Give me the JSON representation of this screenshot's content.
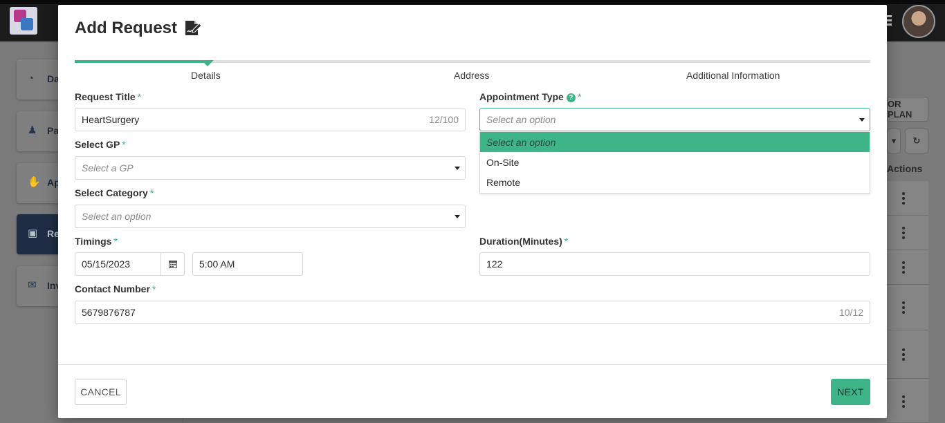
{
  "background": {
    "sidebar": [
      {
        "label": "Da",
        "icon": "dashboard-icon"
      },
      {
        "label": "Pa",
        "icon": "patients-icon"
      },
      {
        "label": "Ap",
        "icon": "appointments-icon"
      },
      {
        "label": "Re",
        "icon": "requests-icon",
        "active": true
      },
      {
        "label": "Inv",
        "icon": "invoice-icon"
      }
    ],
    "plan_button": "OR PLAN",
    "actions_header": "Actions"
  },
  "modal": {
    "title": "Add Request",
    "steps": [
      "Details",
      "Address",
      "Additional Information"
    ],
    "fields": {
      "request_title": {
        "label": "Request Title",
        "value": "HeartSurgery",
        "counter": "12/100"
      },
      "appointment_type": {
        "label": "Appointment Type",
        "placeholder": "Select an option",
        "options": [
          "Select an option",
          "On-Site",
          "Remote"
        ]
      },
      "gp": {
        "label": "Select GP",
        "placeholder": "Select a GP"
      },
      "category": {
        "label": "Select Category",
        "placeholder": "Select an option"
      },
      "timings": {
        "label": "Timings",
        "date": "05/15/2023",
        "time": "5:00 AM"
      },
      "duration": {
        "label": "Duration(Minutes)",
        "value": "122"
      },
      "contact": {
        "label": "Contact Number",
        "value": "5679876787",
        "counter": "10/12"
      }
    },
    "buttons": {
      "cancel": "CANCEL",
      "next": "NEXT"
    },
    "required_mark": "*",
    "help_mark": "?"
  }
}
